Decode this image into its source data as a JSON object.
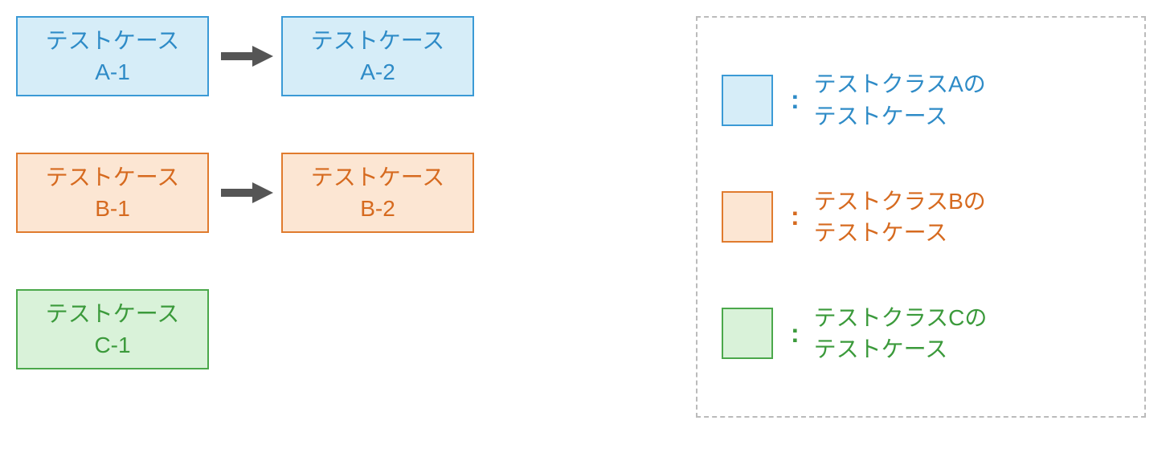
{
  "diagram": {
    "rows": [
      {
        "class": "a",
        "nodes": [
          {
            "line1": "テストケース",
            "line2": "A-1"
          },
          {
            "line1": "テストケース",
            "line2": "A-2"
          }
        ],
        "arrow": true
      },
      {
        "class": "b",
        "nodes": [
          {
            "line1": "テストケース",
            "line2": "B-1"
          },
          {
            "line1": "テストケース",
            "line2": "B-2"
          }
        ],
        "arrow": true
      },
      {
        "class": "c",
        "nodes": [
          {
            "line1": "テストケース",
            "line2": "C-1"
          }
        ],
        "arrow": false
      }
    ]
  },
  "legend": {
    "items": [
      {
        "class": "a",
        "line1": "テストクラスAの",
        "line2": "テストケース"
      },
      {
        "class": "b",
        "line1": "テストクラスBの",
        "line2": "テストケース"
      },
      {
        "class": "c",
        "line1": "テストクラスCの",
        "line2": "テストケース"
      }
    ],
    "colon": ":"
  },
  "colors": {
    "a": {
      "fill": "#d6edf8",
      "border": "#3b9ad6",
      "text": "#2e8bc7"
    },
    "b": {
      "fill": "#fce6d3",
      "border": "#e07b2e",
      "text": "#d66a1f"
    },
    "c": {
      "fill": "#d9f2d9",
      "border": "#4ba84b",
      "text": "#3b9a3b"
    },
    "arrow": "#555555"
  }
}
